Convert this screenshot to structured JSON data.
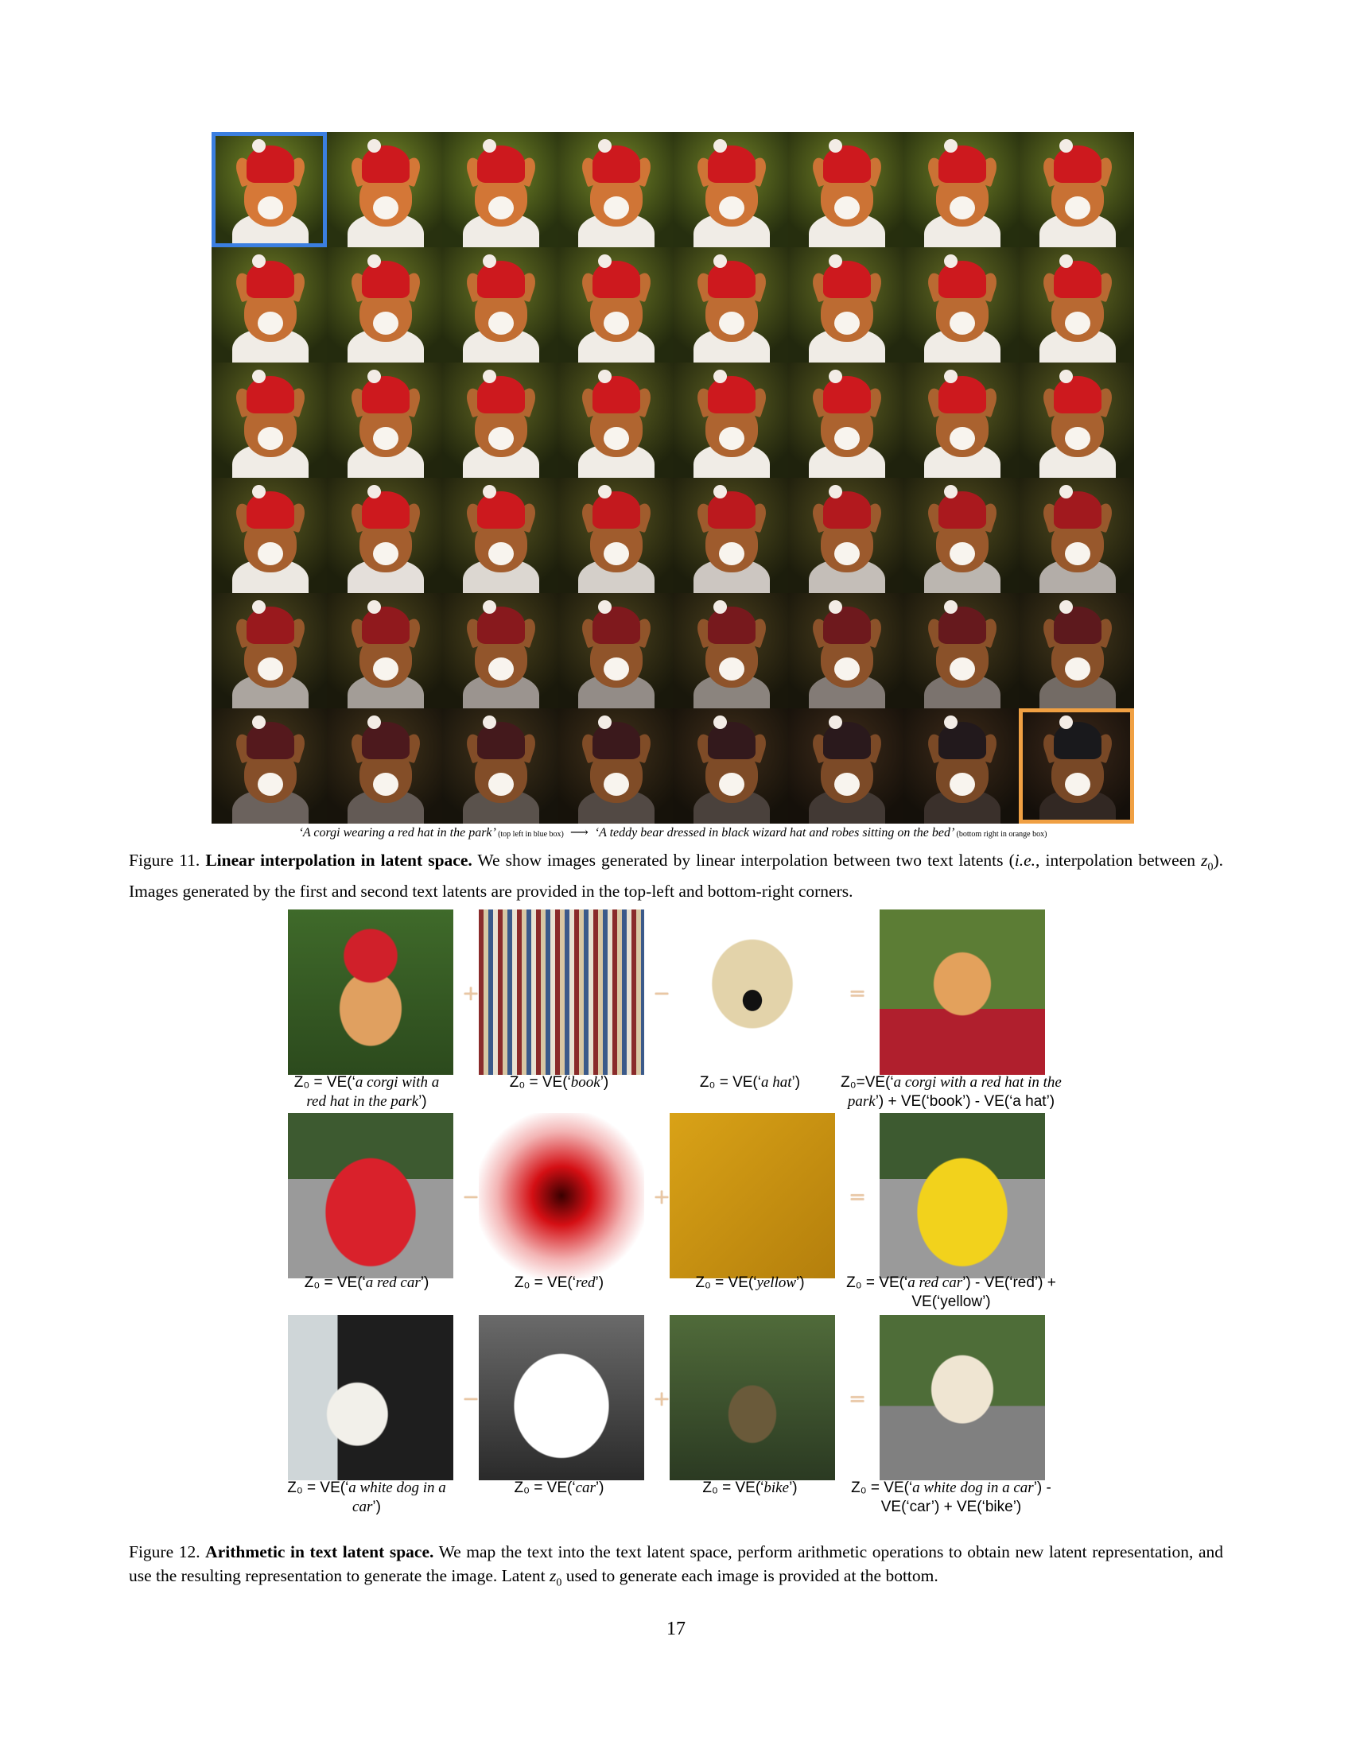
{
  "figure11": {
    "caption_label": "Figure 11.",
    "caption_bold": "Linear interpolation in latent space.",
    "caption_text_1": "We show images generated by linear interpolation between two text latents (",
    "caption_ie": "i.e.",
    "caption_text_2": ", interpolation between ",
    "caption_z0": "z",
    "caption_z0_sub": "0",
    "caption_text_3": "). Images generated by the first and second text latents are provided in the top-left and bottom-right corners.",
    "start_prompt": "‘A corgi wearing a red hat in the park’",
    "start_note": "(top left in blue box)",
    "arrow": "⟶",
    "end_prompt": "‘A teddy bear dressed in black wizard hat and robes sitting on the bed’",
    "end_note": "(bottom right in orange box)",
    "highlight_colors": {
      "start_box": "#3b7fe0",
      "end_box": "#f0a043"
    },
    "rows": 6,
    "cols": 8
  },
  "figure12": {
    "caption_label": "Figure 12.",
    "caption_bold": "Arithmetic in text latent space.",
    "caption_text": "We map the text into the text latent space, perform arithmetic operations to obtain new latent representation, and use the resulting representation to generate the image. Latent",
    "caption_z0": "z",
    "caption_z0_sub": "0",
    "caption_text_end": "used to generate each image is provided at the bottom.",
    "rows": [
      {
        "ops": [
          "+",
          "−",
          "="
        ],
        "labels": [
          {
            "pre": "Z₀ = VE(‘",
            "it": "a corgi with a red hat in the park",
            "post": "’)"
          },
          {
            "pre": "Z₀ = VE(‘",
            "it": "book",
            "post": "’)"
          },
          {
            "pre": "Z₀ = VE(‘",
            "it": "a hat",
            "post": "’)"
          },
          {
            "pre": "Z₀=VE(‘",
            "it": "a corgi with a red hat in the park",
            "post": "’) + VE(‘book’) - VE(‘a hat’)"
          }
        ]
      },
      {
        "ops": [
          "−",
          "+",
          "="
        ],
        "labels": [
          {
            "pre": "Z₀ = VE(‘",
            "it": "a red car",
            "post": "’)"
          },
          {
            "pre": "Z₀ = VE(‘",
            "it": "red",
            "post": "’)"
          },
          {
            "pre": "Z₀ = VE(‘",
            "it": "yellow",
            "post": "’)"
          },
          {
            "pre": "Z₀  = VE(‘",
            "it": "a red car",
            "post": "’) - VE(‘red’) + VE(‘yellow’)"
          }
        ]
      },
      {
        "ops": [
          "−",
          "+",
          "="
        ],
        "labels": [
          {
            "pre": "Z₀ = VE(‘",
            "it": "a white dog in a car",
            "post": "’)"
          },
          {
            "pre": "Z₀ = VE(‘",
            "it": "car",
            "post": "’)"
          },
          {
            "pre": "Z₀ = VE(‘",
            "it": "bike",
            "post": "’)"
          },
          {
            "pre": "Z₀ = VE(‘",
            "it": "a white dog in a car",
            "post": "’) - VE(‘car’) + VE(‘bike’)"
          }
        ]
      }
    ]
  },
  "page_number": "17"
}
